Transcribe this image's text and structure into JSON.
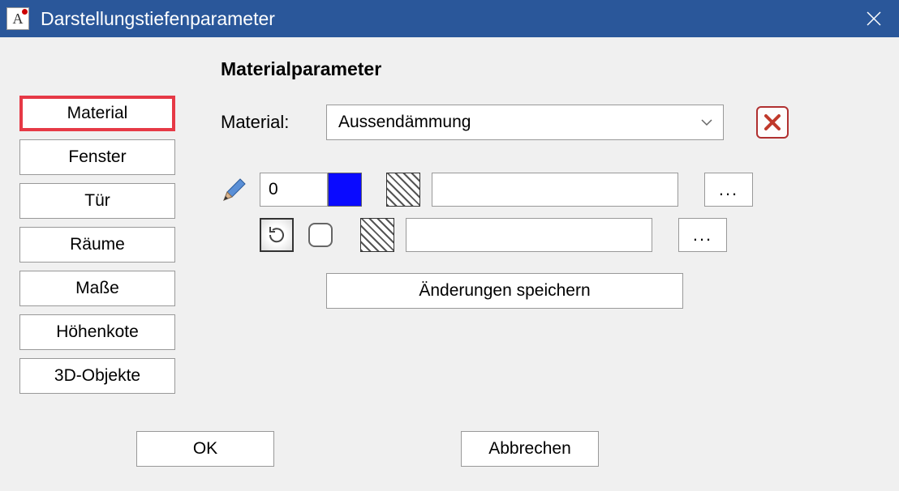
{
  "window": {
    "title": "Darstellungstiefenparameter"
  },
  "sidebar": {
    "tabs": [
      {
        "label": "Material",
        "active": true
      },
      {
        "label": "Fenster",
        "active": false
      },
      {
        "label": "Tür",
        "active": false
      },
      {
        "label": "Räume",
        "active": false
      },
      {
        "label": "Maße",
        "active": false
      },
      {
        "label": "Höhenkote",
        "active": false
      },
      {
        "label": "3D-Objekte",
        "active": false
      }
    ]
  },
  "panel": {
    "title": "Materialparameter",
    "material_label": "Material:",
    "material_value": "Aussendämmung",
    "pen_value": "0",
    "pen_color": "#0a0aff",
    "hatch1_value": "",
    "hatch2_value": "",
    "ellipsis": "...",
    "save_label": "Änderungen speichern"
  },
  "footer": {
    "ok": "OK",
    "cancel": "Abbrechen"
  }
}
